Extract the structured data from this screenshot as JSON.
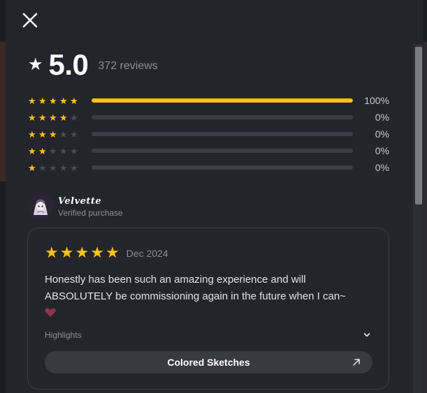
{
  "summary": {
    "rating": "5.0",
    "review_count": "372 reviews"
  },
  "distribution": [
    {
      "stars": 5,
      "percent_label": "100%",
      "fraction": 1.0
    },
    {
      "stars": 4,
      "percent_label": "0%",
      "fraction": 0
    },
    {
      "stars": 3,
      "percent_label": "0%",
      "fraction": 0
    },
    {
      "stars": 2,
      "percent_label": "0%",
      "fraction": 0
    },
    {
      "stars": 1,
      "percent_label": "0%",
      "fraction": 0
    }
  ],
  "review": {
    "reviewer_name": "Velvette",
    "reviewer_status": "Verified purchase",
    "stars": 5,
    "date": "Dec 2024",
    "text": "Honestly has been such an amazing experience and will ABSOLUTELY be commissioning again in the future when I can~",
    "emoji": "heart",
    "highlights_label": "Highlights",
    "tag_label": "Colored Sketches"
  },
  "colors": {
    "star": "#ffc21a",
    "background": "#24242d",
    "muted_text": "#8e8e98"
  },
  "icons": {
    "close": "close-icon",
    "chevron": "chevron-down-icon",
    "arrow": "arrow-up-right-icon"
  }
}
